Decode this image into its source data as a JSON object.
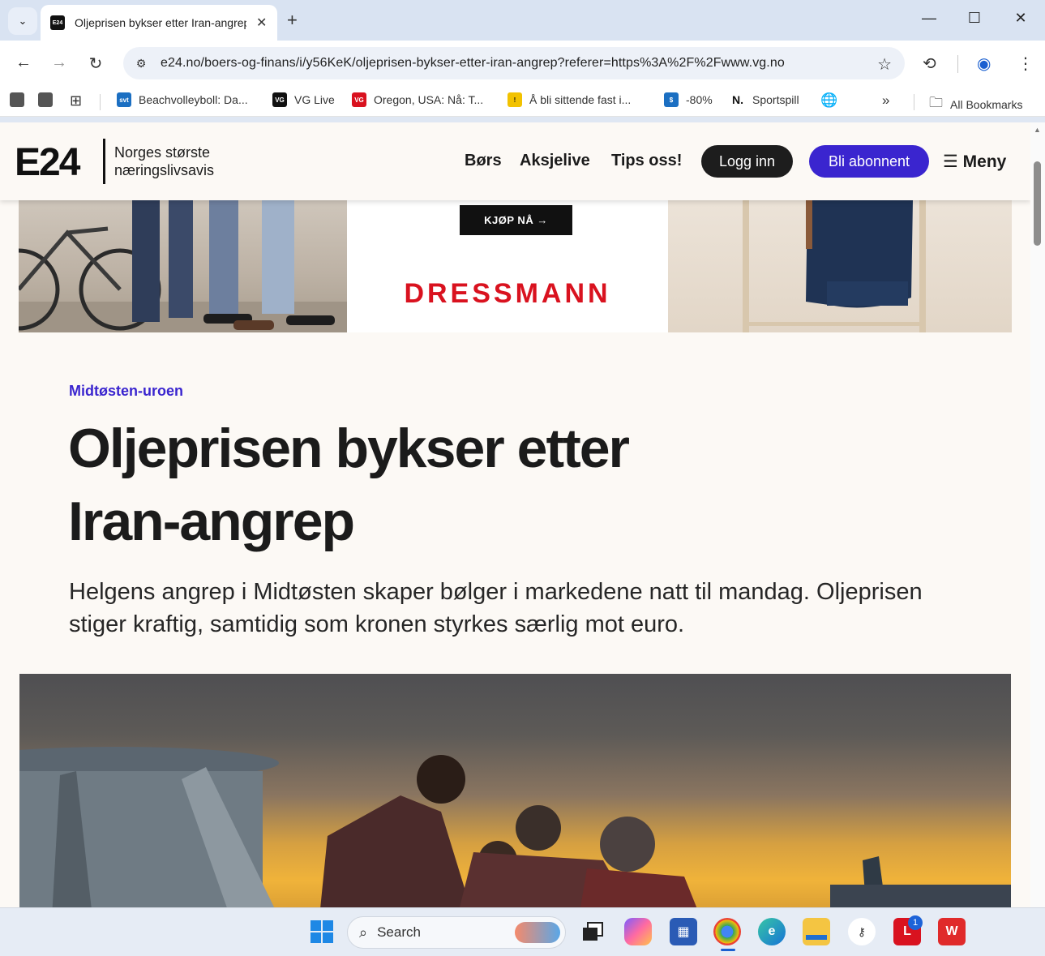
{
  "browser": {
    "tab": {
      "title": "Oljeprisen bykser etter Iran-angrep",
      "favicon_text": "E24"
    },
    "url": "e24.no/boers-og-finans/i/y56KeK/oljeprisen-bykser-etter-iran-angrep?referer=https%3A%2F%2Fwww.vg.no",
    "bookmarks": [
      {
        "label": "Beachvolleyboll: Da...",
        "icon_text": "svt",
        "color": "#1b6fc2"
      },
      {
        "label": "VG Live",
        "icon_text": "VG",
        "color": "#111111"
      },
      {
        "label": "Oregon, USA: Nå: T...",
        "icon_text": "VG",
        "color": "#d9121f"
      },
      {
        "label": "Å bli sittende fast i...",
        "icon_text": "!",
        "color": "#f2c200"
      },
      {
        "label": "-80%",
        "icon_text": "$",
        "color": "#1b6fc2"
      },
      {
        "label": "Sportspill",
        "icon_text": "N.",
        "color": "#111111"
      }
    ],
    "all_bookmarks_label": "All Bookmarks"
  },
  "site": {
    "logo": "E24",
    "tagline_line1": "Norges største",
    "tagline_line2": "næringslivsavis",
    "nav": [
      "Børs",
      "Aksjelive",
      "Tips oss!"
    ],
    "login_label": "Logg inn",
    "subscribe_label": "Bli abonnent",
    "menu_label": "☰ Meny"
  },
  "ad": {
    "cta": "KJØP NÅ →",
    "brand": "DRESSMANN"
  },
  "article": {
    "kicker": "Midtøsten-uroen",
    "headline_line1": "Oljeprisen bykser etter",
    "headline_line2": "Iran-angrep",
    "lead": "Helgens angrep i Midtøsten skaper bølger i markedene natt til mandag. Oljeprisen stiger kraftig, samtidig som kronen styrkes særlig mot euro."
  },
  "taskbar": {
    "search_label": "Search",
    "notification_count": "1"
  },
  "colors": {
    "accent": "#3a25cf",
    "page_bg": "#fcf9f5",
    "ad_brand": "#d9121f"
  }
}
